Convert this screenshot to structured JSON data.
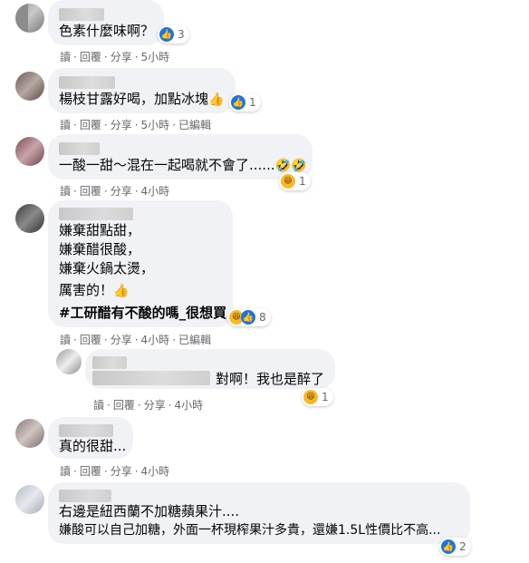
{
  "comments": [
    {
      "text": "色素什麼味啊？",
      "reaction_count": "3",
      "actions": {
        "read": "讀",
        "reply": "回覆",
        "share": "分享",
        "time": "5小時",
        "edited": ""
      }
    },
    {
      "text": "楊枝甘露好喝，加點冰塊",
      "emoji": "👍",
      "reaction_count": "1",
      "actions": {
        "read": "讀",
        "reply": "回覆",
        "share": "分享",
        "time": "5小時",
        "edited": "已編輯"
      }
    },
    {
      "text": "一酸一甜～混在一起喝就不會了......",
      "emoji": "🤣🤣",
      "reaction_count": "1",
      "actions": {
        "read": "讀",
        "reply": "回覆",
        "share": "分享",
        "time": "4小時",
        "edited": ""
      }
    },
    {
      "lines": [
        "嫌棄甜點甜，",
        "嫌棄醋很酸，",
        "嫌棄火鍋太燙，",
        "厲害的！"
      ],
      "emoji": "👍",
      "hashtag": "#工研醋有不酸的嗎_很想買",
      "reaction_count": "8",
      "actions": {
        "read": "讀",
        "reply": "回覆",
        "share": "分享",
        "time": "4小時",
        "edited": "已編輯"
      }
    },
    {
      "text": "對啊！我也是醉了",
      "reaction_count": "1",
      "actions": {
        "read": "讀",
        "reply": "回覆",
        "share": "分享",
        "time": "4小時",
        "edited": ""
      }
    },
    {
      "text": "真的很甜...",
      "actions": {
        "read": "讀",
        "reply": "回覆",
        "share": "分享",
        "time": "4小時",
        "edited": ""
      }
    },
    {
      "lines": [
        "右邊是紐西蘭不加糖蘋果汁....",
        "嫌酸可以自己加糖，外面一杯現榨果汁多貴，還嫌1.5L性價比不高..."
      ],
      "reaction_count": "2"
    }
  ],
  "colors": {
    "bubble": "#f0f2f5",
    "like": "#1b74e4",
    "haha": "#f7b928",
    "meta": "#65676b"
  },
  "icons": {
    "like": "like-icon",
    "haha": "haha-icon"
  }
}
